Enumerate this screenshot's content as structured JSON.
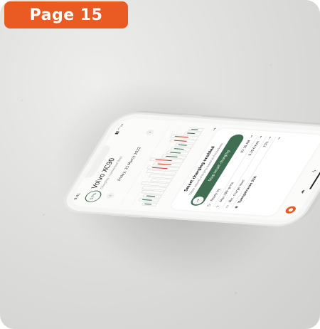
{
  "badge": {
    "label": "Page 15"
  },
  "phone": {
    "status_time": "9:41",
    "header": {
      "soc": "57%",
      "car_name": "Volvo XC90",
      "car_subtitle": "Charging / Connected dock"
    },
    "date_nav": {
      "prev": "‹",
      "date": "Friday, 25 March 2022",
      "next": "›"
    },
    "chart_arrow": "→",
    "smart_charging": {
      "title": "Smart charging enabled",
      "subtitle": "Tibber adjusts charging speed and schedules",
      "button_icon": "→",
      "button_label": "Stop smart charging"
    },
    "settings": [
      {
        "icon": "clock-icon",
        "glyph": "◷",
        "label": "Ready by",
        "value": "07:30 AM",
        "arrow": "→"
      },
      {
        "icon": "bolt-icon",
        "glyph": "ϟ",
        "label": "Max kWh price",
        "value": "0.30 €/kwh",
        "arrow": "→"
      },
      {
        "icon": "battery-icon",
        "glyph": "▭",
        "label": "Min. charge level",
        "value": "75%",
        "arrow": "→"
      },
      {
        "icon": "pin-icon",
        "glyph": "◉",
        "label": "Tuerigstrasse 32A",
        "value": "",
        "arrow": "→"
      }
    ],
    "tabs": [
      {
        "icon": "home-icon",
        "glyph": "●",
        "active": true
      },
      {
        "icon": "cloud-icon",
        "glyph": "☁",
        "active": false
      },
      {
        "icon": "bolt-tab-icon",
        "glyph": "ϟ",
        "active": false
      },
      {
        "icon": "person-icon",
        "glyph": "♙",
        "active": false
      }
    ]
  },
  "colors": {
    "accent": "#ea5a23",
    "brand_green": "#3f6e52",
    "price_red": "#c2432f",
    "bar_gray": "#d9d9d9"
  }
}
